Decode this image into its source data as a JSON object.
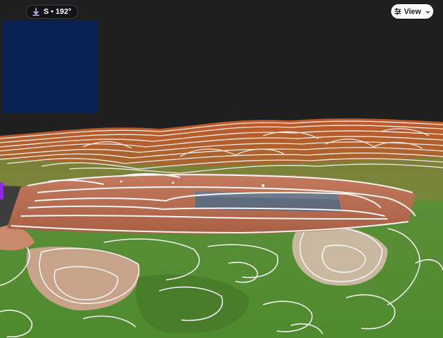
{
  "compass": {
    "label": "S • 192°",
    "icon": "compass-arrow-icon"
  },
  "view_button": {
    "label": "View",
    "icon": "sliders-icon",
    "chevron": "chevron-down-icon"
  },
  "scene": {
    "description_icon": "terrain-3d-view",
    "contour_color": "#f4f4f4"
  },
  "colors": {
    "background": "#1f1f1f",
    "minimap": "#0a2154",
    "side_handle": "#8a2be2",
    "terrain_soil": "#b56a4e",
    "terrain_grass": "#5f9a3a",
    "liner": "#5f6a7d"
  }
}
